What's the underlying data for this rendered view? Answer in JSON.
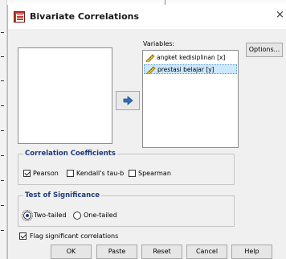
{
  "window": {
    "title": "Bivariate Correlations",
    "close_glyph": "×"
  },
  "icons": [
    "spss-app-icon",
    "move-right-arrow-icon",
    "scale-ruler-icon",
    "close-icon"
  ],
  "colors": {
    "group_title": "#1f3a7a",
    "selected_row": "#cce8ff",
    "dialog_bg": "#f0f0f0"
  },
  "variables": {
    "label": "Variables:",
    "items": [
      {
        "label": "angket kedisiplinan [x]",
        "selected": false
      },
      {
        "label": "prestasi belajar [y]",
        "selected": true
      }
    ]
  },
  "options_button": "Options...",
  "correlation_coefficients": {
    "title": "Correlation Coefficients",
    "pearson": {
      "label": "Pearson",
      "checked": true
    },
    "kendall": {
      "label": "Kendall's tau-b",
      "checked": false
    },
    "spearman": {
      "label": "Spearman",
      "checked": false
    }
  },
  "test_of_significance": {
    "title": "Test of Significance",
    "two_tailed": {
      "label": "Two-tailed",
      "checked": true
    },
    "one_tailed": {
      "label": "One-tailed",
      "checked": false
    }
  },
  "flag_significant": {
    "label": "Flag significant correlations",
    "checked": true
  },
  "buttons": {
    "ok": "OK",
    "paste": "Paste",
    "reset": "Reset",
    "cancel": "Cancel",
    "help": "Help"
  }
}
